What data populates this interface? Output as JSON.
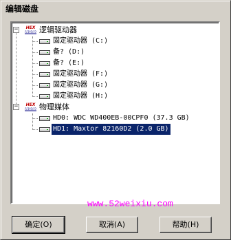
{
  "window": {
    "title": "编辑磁盘"
  },
  "tree": {
    "logical_group": {
      "icon_top": "HEX",
      "icon_bottom": "WORKS",
      "label": "逻辑驱动器",
      "items": [
        {
          "label": "固定驱动器 (C:)"
        },
        {
          "label": "备? (D:)"
        },
        {
          "label": "备? (E:)"
        },
        {
          "label": "固定驱动器 (F:)"
        },
        {
          "label": "固定驱动器 (G:)"
        },
        {
          "label": "固定驱动器 (H:)"
        }
      ]
    },
    "physical_group": {
      "icon_top": "HEX",
      "icon_bottom": "WORKS",
      "label": "物理媒体",
      "items": [
        {
          "label": "HD0: WDC WD400EB-00CPF0 (37.3 GB)"
        },
        {
          "label": "HD1: Maxtor 82160D2 (2.0 GB)"
        }
      ]
    },
    "expander_symbol": "−"
  },
  "watermark": "www.52weixiu.com",
  "buttons": {
    "ok": "确定(O)",
    "cancel": "取消(A)",
    "help": "帮助(H)"
  },
  "colors": {
    "selection": "#0a246a",
    "watermark": "#ff00ff",
    "face": "#d4d0c8"
  }
}
